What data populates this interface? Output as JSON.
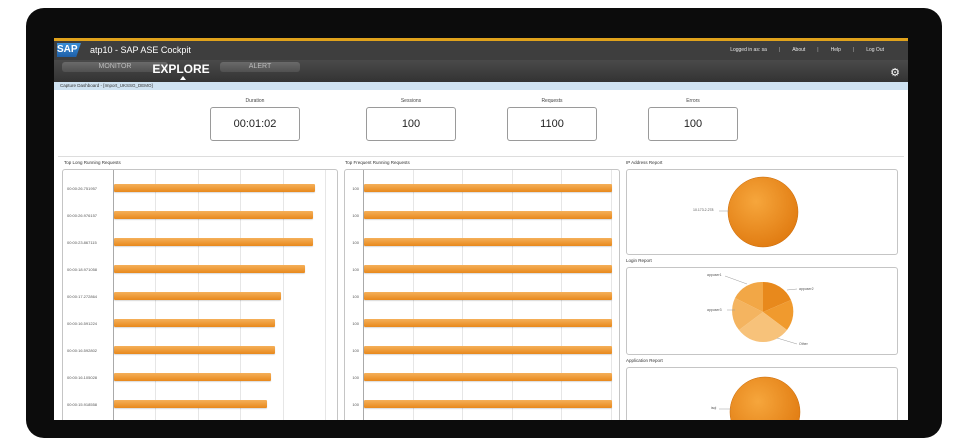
{
  "app": {
    "logo": "SAP",
    "title": "atp10 - SAP ASE Cockpit"
  },
  "top_links": {
    "logged_in": "Logged in as: sa",
    "about": "About",
    "help": "Help",
    "logout": "Log Out"
  },
  "nav": {
    "tabs": [
      {
        "label": "MONITOR"
      },
      {
        "label": "EXPLORE"
      },
      {
        "label": "ALERT"
      }
    ],
    "active": "EXPLORE"
  },
  "breadcrumb": "Capture Dashboard - [Import_UKSSG_DEMO]",
  "metrics": [
    {
      "label": "Duration",
      "value": "00:01:02"
    },
    {
      "label": "Sessions",
      "value": "100"
    },
    {
      "label": "Requests",
      "value": "1100"
    },
    {
      "label": "Errors",
      "value": "100"
    }
  ],
  "panels": {
    "long_running": "Top Long Running Requests",
    "frequent": "Top Frequent Running Requests",
    "ip": "IP Address Report",
    "login": "Login Report",
    "application": "Application Report"
  },
  "long_running_rows": [
    {
      "label": "00:00:26.751957",
      "value": 0.95
    },
    {
      "label": "00:00:26.976157",
      "value": 0.94
    },
    {
      "label": "00:00:23.867115",
      "value": 0.94
    },
    {
      "label": "00:00:18.971058",
      "value": 0.9
    },
    {
      "label": "00:00:17.272864",
      "value": 0.79
    },
    {
      "label": "00:00:16.591224",
      "value": 0.76
    },
    {
      "label": "00:00:16.592802",
      "value": 0.76
    },
    {
      "label": "00:00:16.105028",
      "value": 0.74
    },
    {
      "label": "00:00:15.918558",
      "value": 0.72
    }
  ],
  "frequent_rows": [
    {
      "label": "100",
      "value": 1.0
    },
    {
      "label": "100",
      "value": 1.0
    },
    {
      "label": "100",
      "value": 1.0
    },
    {
      "label": "100",
      "value": 1.0
    },
    {
      "label": "100",
      "value": 1.0
    },
    {
      "label": "100",
      "value": 1.0
    },
    {
      "label": "100",
      "value": 1.0
    },
    {
      "label": "100",
      "value": 1.0
    },
    {
      "label": "100",
      "value": 1.0
    }
  ],
  "ip_pie": {
    "label": "10.173.2.278"
  },
  "login_pie": {
    "labels": [
      "appuser1",
      "appuser2",
      "appuser3",
      "Other"
    ]
  },
  "app_pie": {
    "label": "isql"
  },
  "colors": {
    "accent": "#e8891c",
    "gold": "#e0a21b",
    "topbar": "#3e3e3e"
  }
}
